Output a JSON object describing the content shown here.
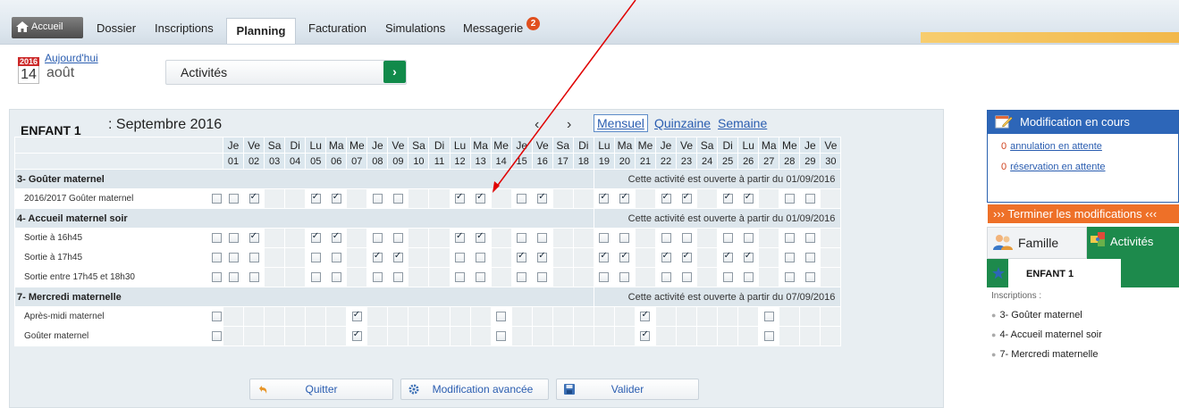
{
  "nav": {
    "home": "Accueil",
    "tabs": [
      "Dossier",
      "Inscriptions",
      "Planning",
      "Facturation",
      "Simulations",
      "Messagerie"
    ],
    "active_tab": "Planning",
    "messages_badge": "2"
  },
  "date": {
    "year": "2016",
    "today_link": "Aujourd'hui",
    "day": "14",
    "month": "août"
  },
  "activity_select": {
    "label": "Activités",
    "go": "›"
  },
  "planning": {
    "child": "ENFANT 1",
    "month": ": Septembre 2016",
    "prev": "‹",
    "next": "›",
    "views": {
      "monthly": "Mensuel",
      "fortnight": "Quinzaine",
      "week": "Semaine"
    },
    "weekdays": [
      "Je",
      "Ve",
      "Sa",
      "Di",
      "Lu",
      "Ma",
      "Me",
      "Je",
      "Ve",
      "Sa",
      "Di",
      "Lu",
      "Ma",
      "Me",
      "Je",
      "Ve",
      "Sa",
      "Di",
      "Lu",
      "Ma",
      "Me",
      "Je",
      "Ve",
      "Sa",
      "Di",
      "Lu",
      "Ma",
      "Me",
      "Je",
      "Ve"
    ],
    "days": [
      "01",
      "02",
      "03",
      "04",
      "05",
      "06",
      "07",
      "08",
      "09",
      "10",
      "11",
      "12",
      "13",
      "14",
      "15",
      "16",
      "17",
      "18",
      "19",
      "20",
      "21",
      "22",
      "23",
      "24",
      "25",
      "26",
      "27",
      "28",
      "29",
      "30"
    ],
    "sections": [
      {
        "title": "3- Goûter maternel",
        "info": "Cette activité est ouverte à partir du 01/09/2016",
        "rows": [
          {
            "label": "2016/2017 Goûter maternel",
            "cells": "CXNN XXN CC NN XXN CX NN XXN XXN XX N CC"
          }
        ]
      },
      {
        "title": "4- Accueil maternel soir",
        "info": "Cette activité est ouverte à partir du 01/09/2016",
        "rows": [
          {
            "label": "Sortie à 16h45",
            "cells": "CXNN XXN CC NN XXN CC NN CCN CCN CC N CC"
          },
          {
            "label": "Sortie à 17h45",
            "cells": "CCNN CCN XX NN CCN XX NN XXN XXN XX N CC"
          },
          {
            "label": "Sortie entre 17h45 et 18h30",
            "cells": "CCNN CCN CC NN CCN CC NN CCN CCN CC N CC"
          }
        ]
      },
      {
        "title": "7- Mercredi maternelle",
        "info": "Cette activité est ouverte à partir du 07/09/2016",
        "rows": [
          {
            "label": "Après-midi maternel",
            "cells": "NNNN NNX NN NN NNC NN NN NNX NNN NN C NN"
          },
          {
            "label": "Goûter maternel",
            "cells": "NNNN NNX NN NN NNC NN NN NNX NNN NN C NN"
          }
        ]
      }
    ]
  },
  "buttons": {
    "quit": "Quitter",
    "advanced": "Modification avancée",
    "validate": "Valider"
  },
  "right": {
    "mod_title": "Modification en cours",
    "cancel_count": "0",
    "cancel_text": "annulation en attente",
    "reserve_count": "0",
    "reserve_text": "réservation en attente",
    "finish": "››› Terminer les modifications ‹‹‹",
    "tab_family": "Famille",
    "tab_activities": "Activités",
    "child": "ENFANT 1",
    "insc_title": "Inscriptions :",
    "inscriptions": [
      "3- Goûter maternel",
      "4- Accueil maternel soir",
      "7- Mercredi maternelle"
    ]
  },
  "colors": {
    "accent_blue": "#2d66b8",
    "green": "#1d8a4c",
    "orange": "#ee7028",
    "red_badge": "#e0501f"
  }
}
